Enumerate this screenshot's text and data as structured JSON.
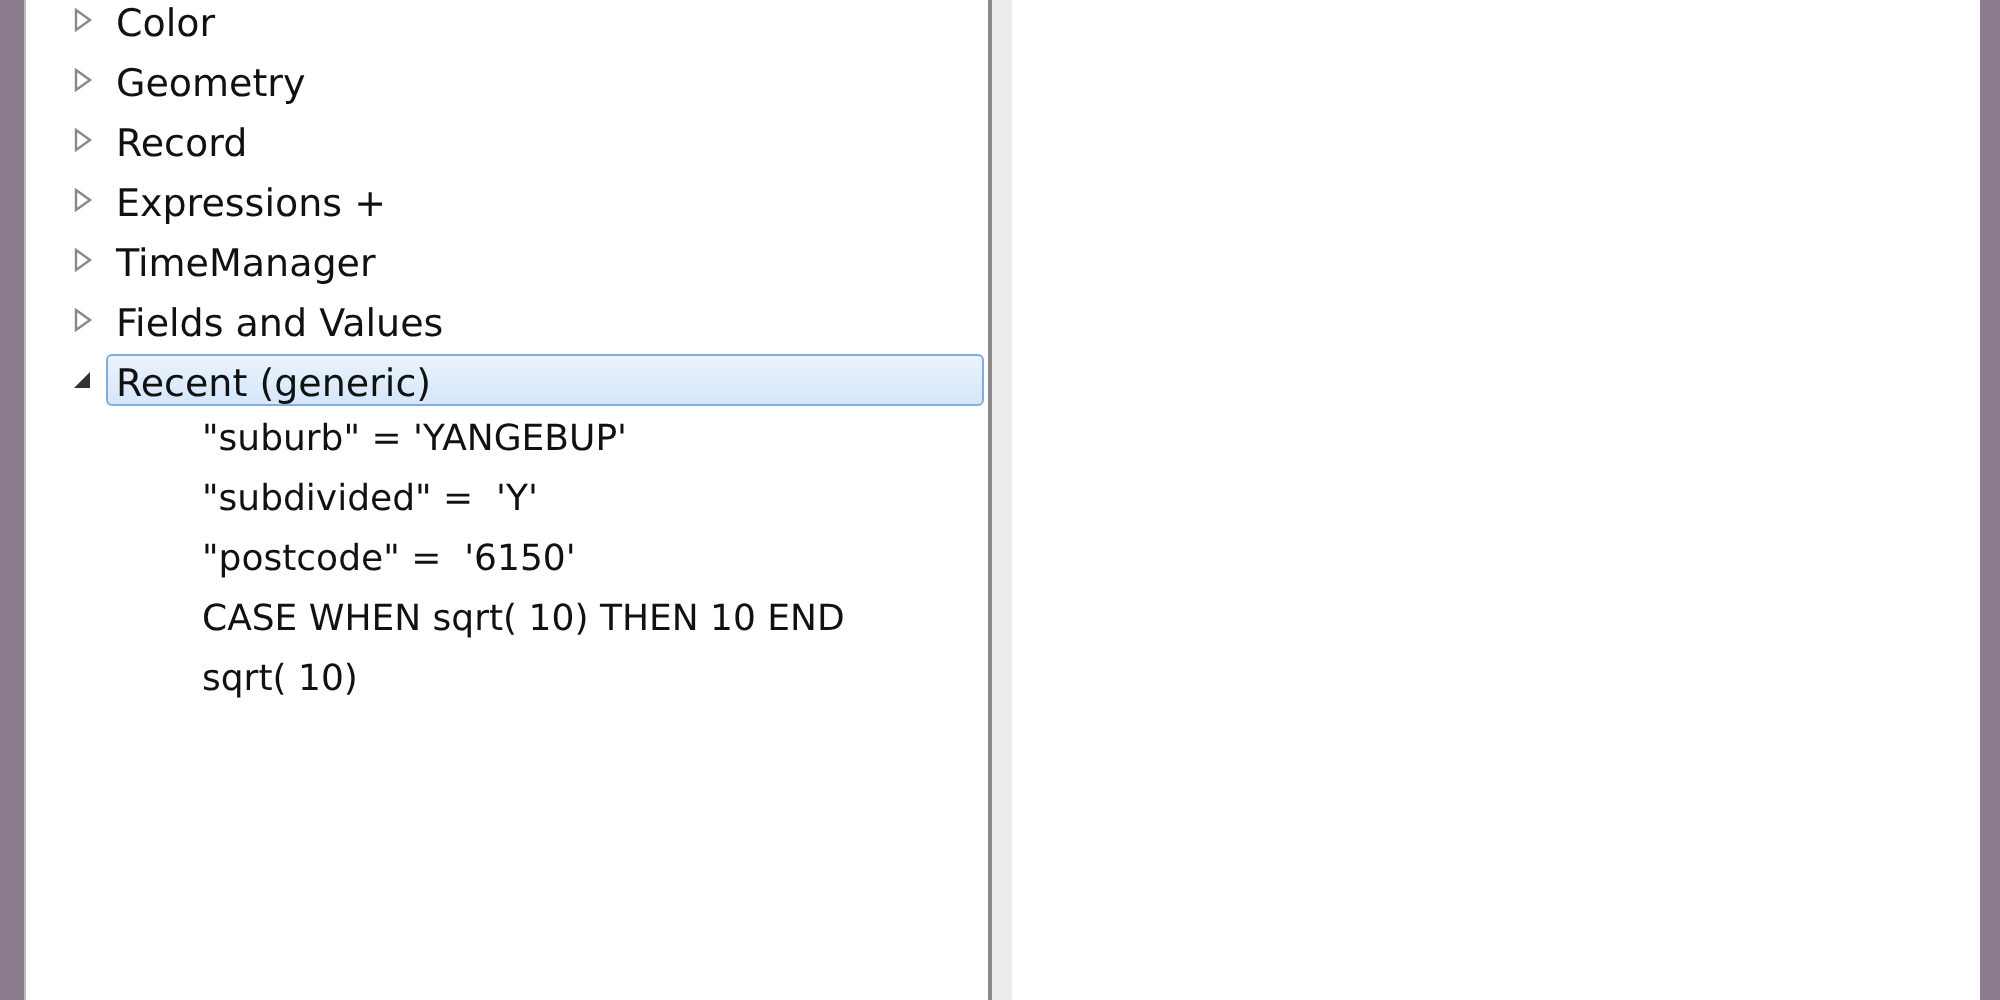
{
  "tree": [
    {
      "label": "Color",
      "expanded": false,
      "selected": false
    },
    {
      "label": "Geometry",
      "expanded": false,
      "selected": false
    },
    {
      "label": "Record",
      "expanded": false,
      "selected": false
    },
    {
      "label": "Expressions +",
      "expanded": false,
      "selected": false
    },
    {
      "label": "TimeManager",
      "expanded": false,
      "selected": false
    },
    {
      "label": "Fields and Values",
      "expanded": false,
      "selected": false
    },
    {
      "label": "Recent (generic)",
      "expanded": true,
      "selected": true,
      "children": [
        {
          "label": "\"suburb\" = 'YANGEBUP'"
        },
        {
          "label": "\"subdivided\" =  'Y'"
        },
        {
          "label": "\"postcode\" =  '6150'"
        },
        {
          "label": "CASE WHEN sqrt( 10) THEN 10 END"
        },
        {
          "label": "sqrt( 10)"
        }
      ]
    }
  ]
}
